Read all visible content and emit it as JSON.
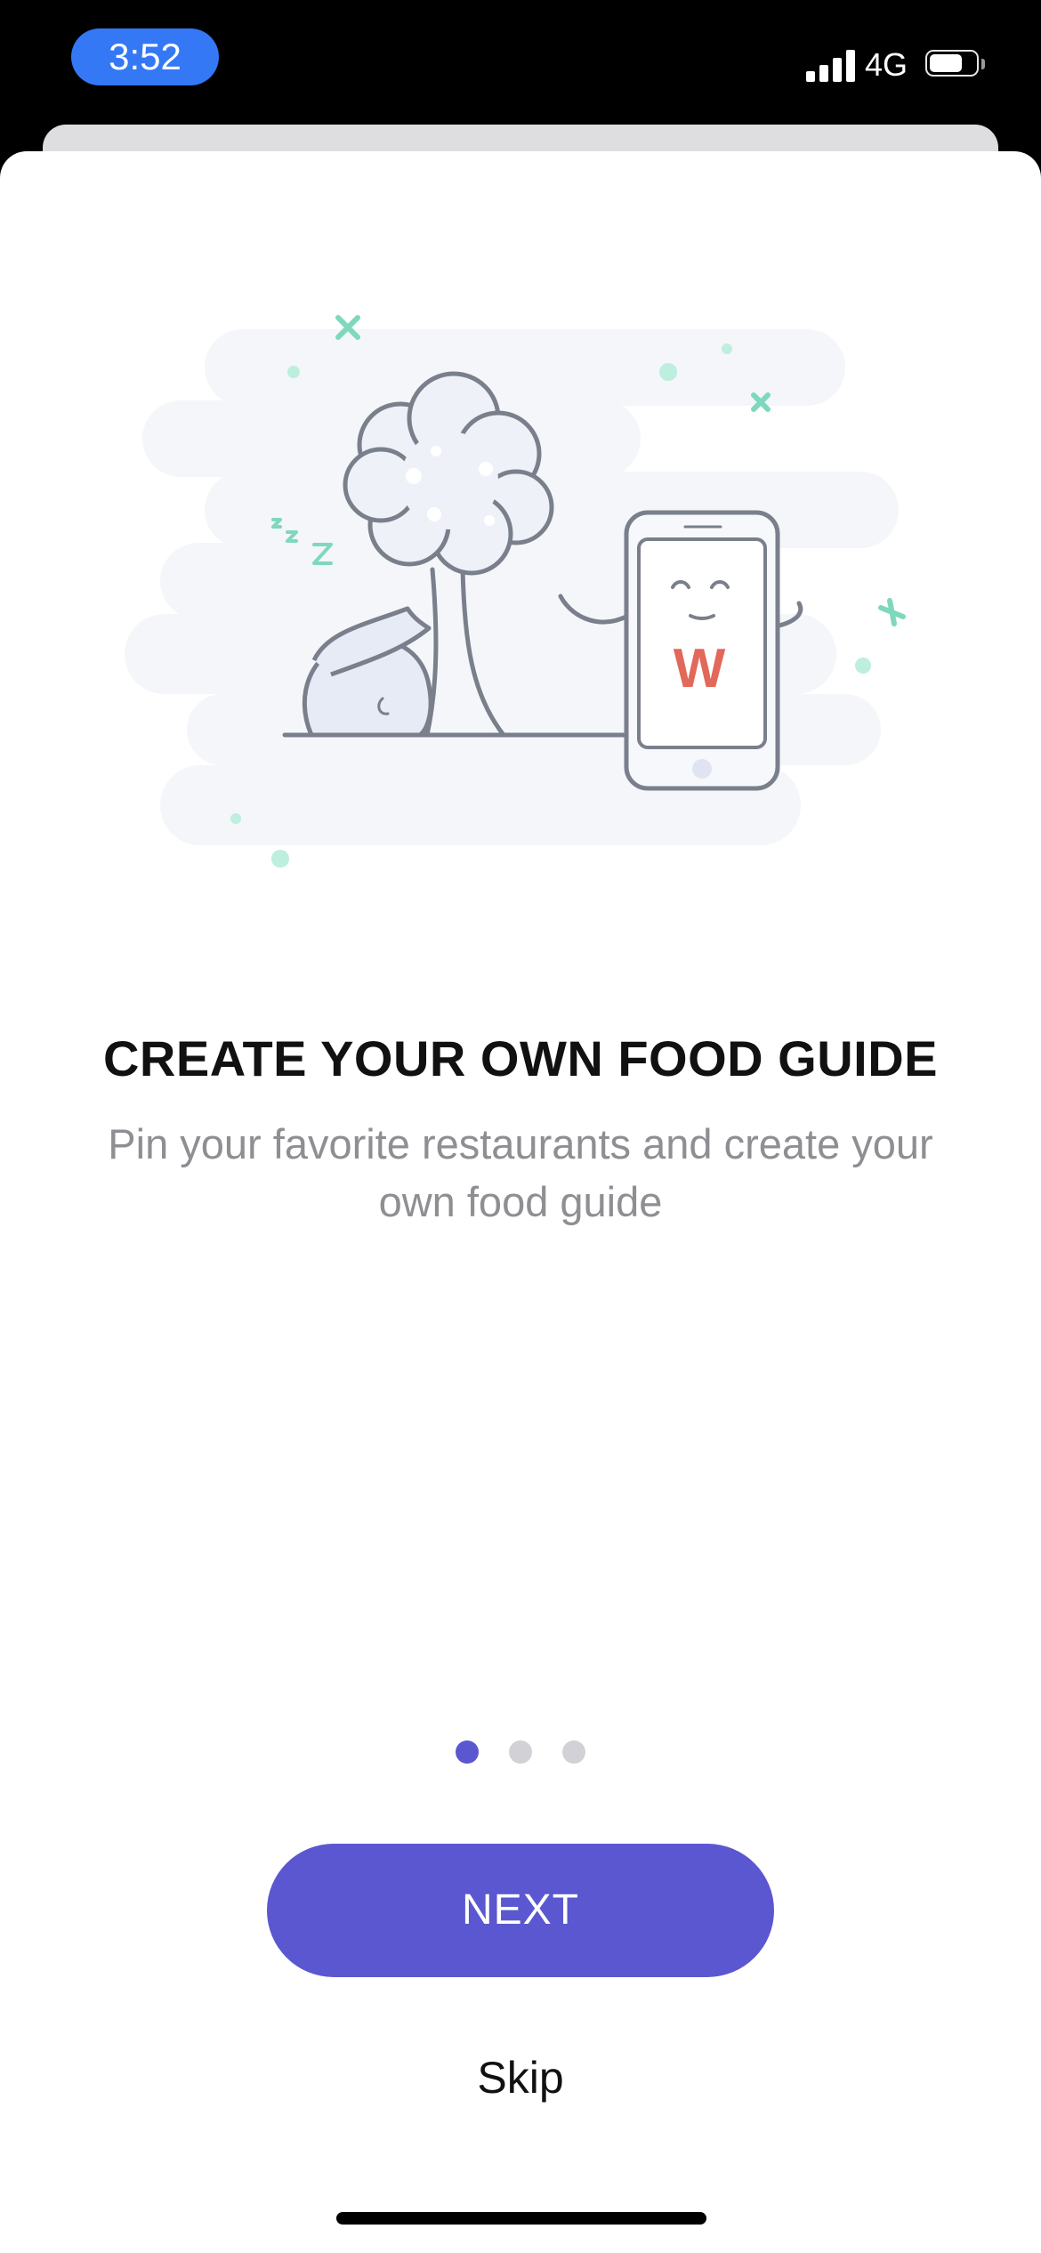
{
  "status_bar": {
    "time": "3:52",
    "network": "4G",
    "icons": [
      "signal-icon",
      "battery-icon"
    ]
  },
  "onboarding": {
    "title": "CREATE YOUR OWN FOOD GUIDE",
    "subtitle": "Pin your favorite restaurants and create your own food guide",
    "illustration_icon": "sleeping-bag-tree-phone-illustration",
    "phone_logo": "W",
    "page_count": 3,
    "current_page": 1
  },
  "actions": {
    "next_label": "NEXT",
    "skip_label": "Skip"
  },
  "colors": {
    "accent": "#5B57D0",
    "status_time_pill": "#3478F6",
    "logo": "#E2685A",
    "sparkle": "#7FD8BE"
  }
}
